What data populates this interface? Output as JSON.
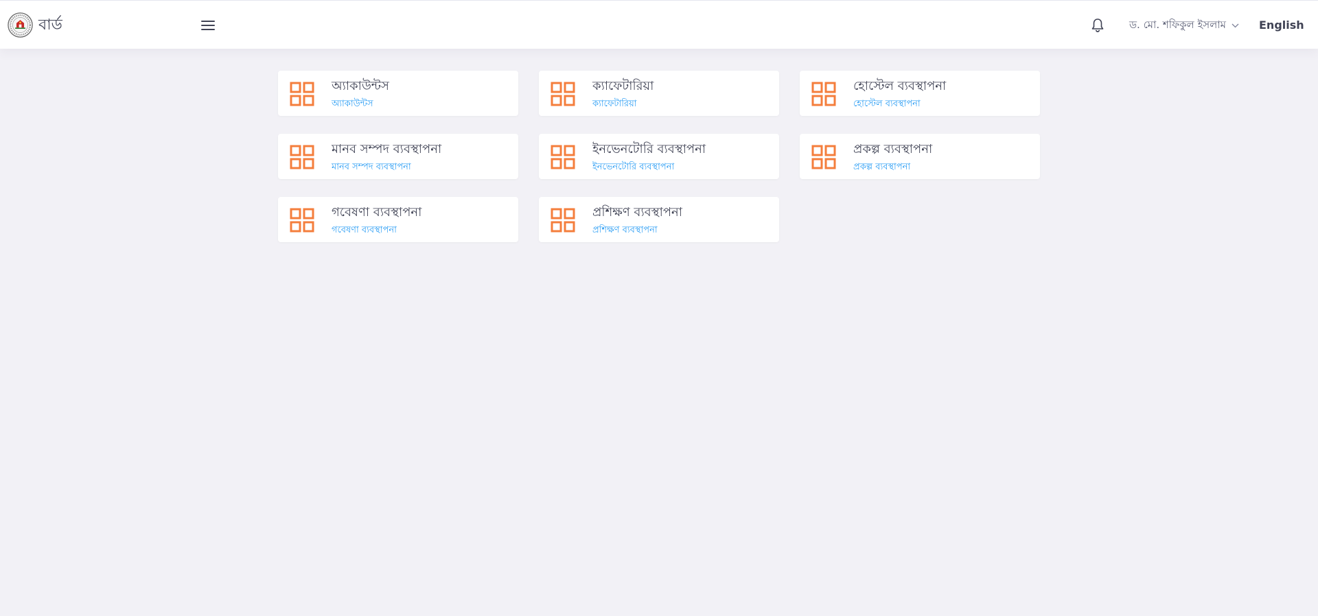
{
  "header": {
    "brand_name": "বার্ড",
    "logo_icon": "organization-seal-icon",
    "menu_icon": "hamburger-menu-icon",
    "notification_icon": "bell-icon",
    "user_name": "ড. মো. শফিকুল ইসলাম",
    "user_chevron_icon": "chevron-down-icon",
    "language_label": "English"
  },
  "theme": {
    "accent_color": "#f47e3c",
    "link_color": "#2a9df4",
    "background_color": "#f2f1f6"
  },
  "modules": [
    {
      "title": "অ্যাকাউন্টস",
      "subtitle": "অ্যাকাউন্টস",
      "icon": "grid-apps-icon"
    },
    {
      "title": "ক্যাফেটারিয়া",
      "subtitle": "ক্যাফেটারিয়া",
      "icon": "grid-apps-icon"
    },
    {
      "title": "হোস্টেল ব্যবস্থাপনা",
      "subtitle": "হোস্টেল ব্যবস্থাপনা",
      "icon": "grid-apps-icon"
    },
    {
      "title": "মানব সম্পদ ব্যবস্থাপনা",
      "subtitle": "মানব সম্পদ ব্যবস্থাপনা",
      "icon": "grid-apps-icon"
    },
    {
      "title": "ইনভেনটোরি ব্যবস্থাপনা",
      "subtitle": "ইনভেনটোরি ব্যবস্থাপনা",
      "icon": "grid-apps-icon"
    },
    {
      "title": "প্রকল্প ব্যবস্থাপনা",
      "subtitle": "প্রকল্প ব্যবস্থাপনা",
      "icon": "grid-apps-icon"
    },
    {
      "title": "গবেষণা ব্যবস্থাপনা",
      "subtitle": "গবেষণা ব্যবস্থাপনা",
      "icon": "grid-apps-icon"
    },
    {
      "title": "প্রশিক্ষণ ব্যবস্থাপনা",
      "subtitle": "প্রশিক্ষণ ব্যবস্থাপনা",
      "icon": "grid-apps-icon"
    }
  ]
}
